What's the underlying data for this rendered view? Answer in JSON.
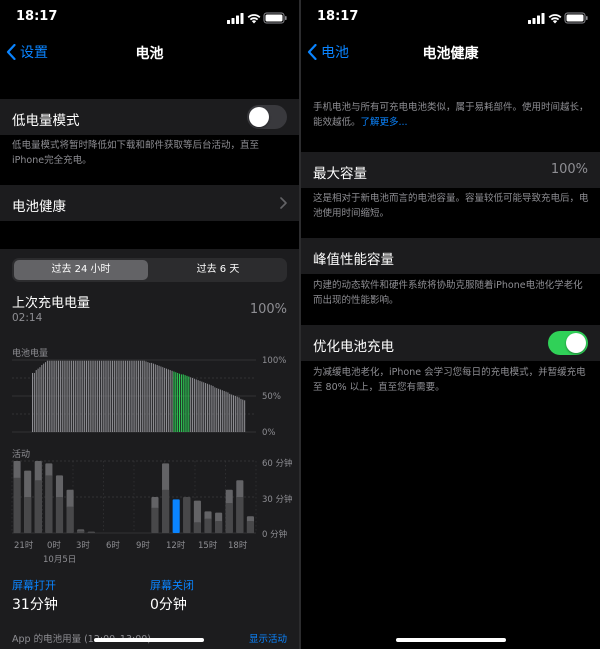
{
  "status_time": "18:17",
  "left": {
    "back_label": "设置",
    "title": "电池",
    "low_power": {
      "label": "低电量模式",
      "enabled": false,
      "footer": "低电量模式将暂时降低如下载和邮件获取等后台活动，直至iPhone完全充电。"
    },
    "battery_health_label": "电池健康",
    "tabs": [
      "过去 24 小时",
      "过去 6 天"
    ],
    "last_charge": {
      "label": "上次充电电量",
      "time": "02:14",
      "value": "100%"
    },
    "level_chart": {
      "title": "电池电量",
      "y_ticks": [
        "100%",
        "50%",
        "0%"
      ]
    },
    "activity_chart": {
      "title": "活动",
      "y_ticks": [
        "60 分钟",
        "30 分钟",
        "0 分钟"
      ],
      "x_ticks": [
        "21时",
        "0时",
        "3时",
        "6时",
        "9时",
        "12时",
        "15时",
        "18时"
      ],
      "date_label": "10月5日"
    },
    "screen_on": {
      "label": "屏幕打开",
      "value": "31分钟"
    },
    "screen_off": {
      "label": "屏幕关闭",
      "value": "0分钟"
    },
    "app_usage_label": "App 的电池用量 (12:00–13:00)",
    "show_activity_label": "显示活动"
  },
  "right": {
    "back_label": "电池",
    "title": "电池健康",
    "intro": "手机电池与所有可充电电池类似，属于易耗部件。使用时间越长，能效越低。",
    "learn_more": "了解更多...",
    "max_capacity": {
      "label": "最大容量",
      "value": "100%",
      "footer": "这是相对于新电池而言的电池容量。容量较低可能导致充电后，电池使用时间缩短。"
    },
    "peak": {
      "label": "峰值性能容量",
      "footer": "内建的动态软件和硬件系统将协助克服随着iPhone电池化学老化而出现的性能影响。"
    },
    "optimized": {
      "label": "优化电池充电",
      "enabled": true,
      "footer": "为减缓电池老化，iPhone 会学习您每日的充电模式，并暂缓充电至 80% 以上，直至您有需要。"
    }
  },
  "chart_data": [
    {
      "type": "bar",
      "title": "电池电量",
      "ylim": [
        0,
        100
      ],
      "y_tick_labels": [
        "100%",
        "50%",
        "0%"
      ],
      "values": [
        82,
        82,
        86,
        88,
        90,
        93,
        95,
        97,
        99,
        99,
        99,
        99,
        99,
        99,
        99,
        99,
        99,
        99,
        99,
        99,
        99,
        99,
        99,
        99,
        99,
        99,
        99,
        99,
        99,
        99,
        99,
        99,
        99,
        99,
        99,
        99,
        99,
        99,
        99,
        99,
        99,
        99,
        99,
        99,
        99,
        99,
        99,
        99,
        99,
        99,
        99,
        99,
        99,
        99,
        99,
        99,
        99,
        99,
        99,
        99,
        99,
        98,
        97,
        96,
        96,
        95,
        94,
        93,
        92,
        91,
        90,
        89,
        88,
        87,
        86,
        85,
        84,
        83,
        82,
        81,
        80,
        80,
        79,
        78,
        77,
        76,
        75,
        74,
        73,
        72,
        71,
        70,
        69,
        68,
        67,
        66,
        65,
        64,
        62,
        61,
        60,
        59,
        58,
        57,
        56,
        55,
        53,
        52,
        51,
        50,
        49,
        48,
        46,
        45,
        44
      ],
      "charging_range": [
        76,
        84
      ],
      "colors": {
        "normal": "#8e8e93",
        "charging": "#30d158"
      }
    },
    {
      "type": "bar",
      "title": "活动",
      "ylim": [
        0,
        60
      ],
      "y_tick_labels": [
        "60 分钟",
        "30 分钟",
        "0 分钟"
      ],
      "x_tick_labels": [
        "21时",
        "0时",
        "3时",
        "6时",
        "9时",
        "12时",
        "15时",
        "18时"
      ],
      "series": [
        {
          "values": [
            60,
            52,
            60,
            58,
            48,
            36,
            3,
            1,
            0,
            0,
            0,
            0,
            0,
            30,
            58,
            28,
            30,
            27,
            18,
            17,
            36,
            44,
            14
          ]
        },
        {
          "values": [
            46,
            30,
            44,
            48,
            30,
            22,
            2,
            1,
            0,
            0,
            0,
            0,
            0,
            21,
            36,
            20,
            30,
            9,
            12,
            10,
            25,
            30,
            10
          ]
        }
      ],
      "highlight_index": 15,
      "colors": {
        "total": "#636366",
        "on": "#48484a",
        "highlight": "#0a84ff"
      }
    }
  ]
}
